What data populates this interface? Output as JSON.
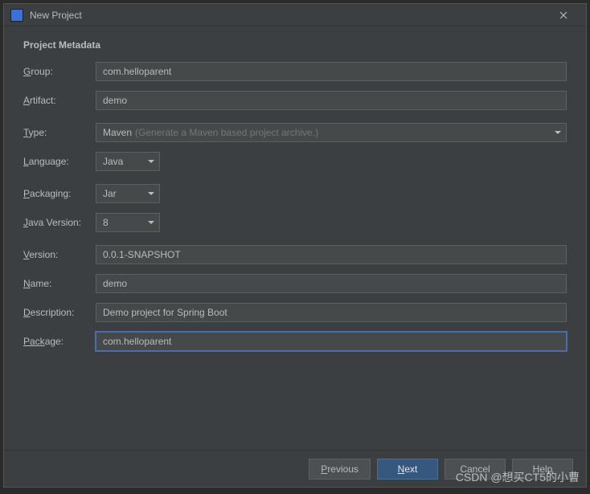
{
  "titlebar": {
    "title": "New Project"
  },
  "section_title": "Project Metadata",
  "labels": {
    "group": "roup:",
    "artifact": "rtifact:",
    "type": "ype:",
    "language": "anguage:",
    "packaging": "ackaging:",
    "java_version": "ava Version:",
    "version": "ersion:",
    "name": "ame:",
    "description": "escription:",
    "package": "age:"
  },
  "underlines": {
    "group": "G",
    "artifact": "A",
    "type": "T",
    "language": "L",
    "packaging": "P",
    "java_version": "J",
    "version": "V",
    "name": "N",
    "description": "D",
    "package": "Pack"
  },
  "values": {
    "group": "com.helloparent",
    "artifact": "demo",
    "type": "Maven",
    "type_hint": "(Generate a Maven based project archive.)",
    "language": "Java",
    "packaging": "Jar",
    "java_version": "8",
    "version": "0.0.1-SNAPSHOT",
    "name": "demo",
    "description": "Demo project for Spring Boot",
    "package": "com.helloparent"
  },
  "buttons": {
    "previous": "revious",
    "previous_u": "P",
    "next": "ext",
    "next_u": "N",
    "cancel": "Cancel",
    "help": "Help"
  },
  "watermark": "CSDN @想买CT5的小曹"
}
